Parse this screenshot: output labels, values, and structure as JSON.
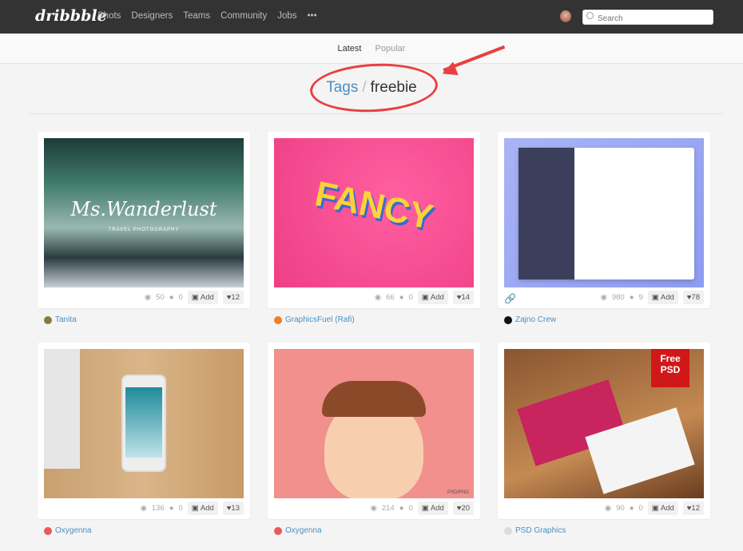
{
  "header": {
    "logo": "dribbble",
    "nav": [
      "Shots",
      "Designers",
      "Teams",
      "Community",
      "Jobs",
      "•••"
    ],
    "search_placeholder": "Search"
  },
  "subnav": {
    "tabs": [
      "Latest",
      "Popular"
    ],
    "active": "Latest"
  },
  "breadcrumb": {
    "root": "Tags",
    "separator": "/",
    "current": "freebie"
  },
  "annotation_color": "#e84040",
  "shots": [
    {
      "views": "50",
      "comments": "0",
      "add": "Add",
      "likes": "12",
      "author": "Tanita",
      "avatar_color": "#8a7a40",
      "image_text": "Ms.Wanderlust",
      "image_subtext": "TRAVEL PHOTOGRAPHY"
    },
    {
      "views": "66",
      "comments": "0",
      "add": "Add",
      "likes": "14",
      "author": "GraphicsFuel (Rafi)",
      "avatar_color": "#f08020",
      "image_text": "FANCY"
    },
    {
      "views": "980",
      "comments": "9",
      "add": "Add",
      "likes": "78",
      "author": "Zajno Crew",
      "avatar_color": "#111111"
    },
    {
      "views": "136",
      "comments": "0",
      "add": "Add",
      "likes": "13",
      "author": "Oxygenna",
      "avatar_color": "#e85a5a"
    },
    {
      "views": "214",
      "comments": "0",
      "add": "Add",
      "likes": "20",
      "author": "Oxygenna",
      "avatar_color": "#e85a5a",
      "image_text": "PSD/PNG"
    },
    {
      "views": "90",
      "comments": "0",
      "add": "Add",
      "likes": "12",
      "author": "PSD Graphics",
      "avatar_color": "#dddddd",
      "image_text": "Free PSD"
    }
  ]
}
